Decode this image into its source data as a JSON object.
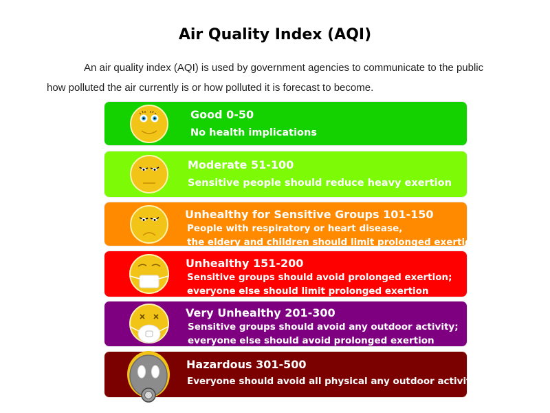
{
  "page": {
    "title": "Air Quality Index (AQI)",
    "intro_line1": "An air quality index (AQI) is used by government agencies to communicate to the public",
    "intro_line2": "how polluted the air currently is or how polluted it is forecast to become."
  },
  "levels": [
    {
      "title": "Good 0-50",
      "desc1": "No health implications",
      "desc2": "",
      "color": "#14d100",
      "face_icon": "happy-face-icon"
    },
    {
      "title": "Moderate 51-100",
      "desc1": "Sensitive people should reduce  heavy exertion",
      "desc2": "",
      "color": "#7dfa06",
      "face_icon": "neutral-face-icon"
    },
    {
      "title": "Unhealthy for Sensitive Groups 101-150",
      "desc1": "People with respiratory or heart disease,",
      "desc2": "the eldery and children should limit prolonged exertion",
      "color": "#ff8a00",
      "face_icon": "frown-face-icon"
    },
    {
      "title": "Unhealthy 151-200",
      "desc1": "Sensitive groups should avoid prolonged exertion;",
      "desc2": "everyone else should limit prolonged exertion",
      "color": "#ff0000",
      "face_icon": "mask-face-icon"
    },
    {
      "title": "Very Unhealthy 201-300",
      "desc1": "Sensitive groups should avoid any outdoor activity;",
      "desc2": "everyone else should avoid prolonged exertion",
      "color": "#7e0080",
      "face_icon": "respirator-face-icon"
    },
    {
      "title": "Hazardous 301-500",
      "desc1": "Everyone should avoid all physical any outdoor activity",
      "desc2": "",
      "color": "#7b0000",
      "face_icon": "gas-mask-icon"
    }
  ]
}
